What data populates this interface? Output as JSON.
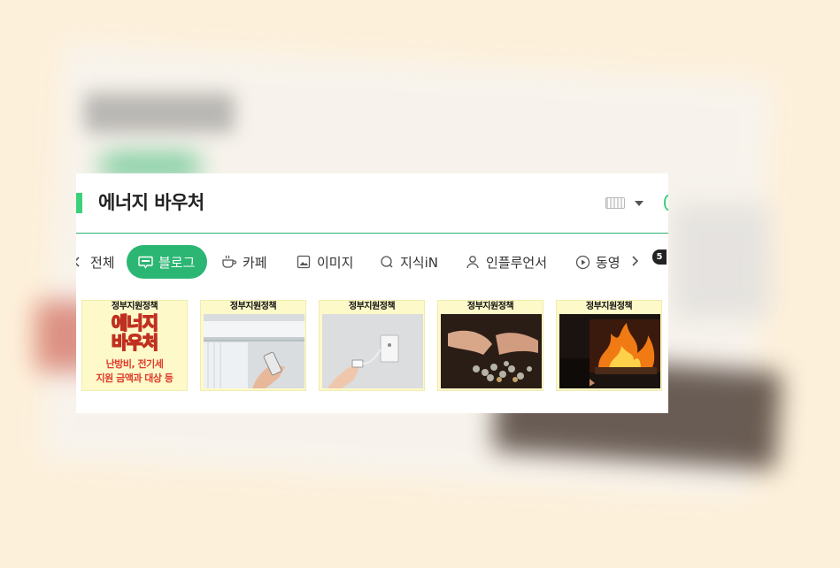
{
  "search": {
    "query": "에너지 바우처"
  },
  "tabs": [
    {
      "label": "전체",
      "icon": "chevron-left-icon"
    },
    {
      "label": "블로그",
      "icon": "blog-icon",
      "active": true
    },
    {
      "label": "카페",
      "icon": "cafe-icon"
    },
    {
      "label": "이미지",
      "icon": "image-icon"
    },
    {
      "label": "지식iN",
      "icon": "knowledge-icon"
    },
    {
      "label": "인플루언서",
      "icon": "person-icon"
    },
    {
      "label": "동영",
      "icon": "play-icon"
    }
  ],
  "more_icon": "chevron-right-icon",
  "thumbnails": [
    {
      "header": "정부지원정책",
      "main": "에너지\n바우처",
      "sub1": "난방비, 전기세",
      "sub2": "지원 금액과 대상 등"
    },
    {
      "header": "정부지원정책",
      "image": "air-conditioner-remote"
    },
    {
      "header": "정부지원정책",
      "image": "power-outlet-plug"
    },
    {
      "header": "정부지원정책",
      "image": "hands-coins"
    },
    {
      "header": "정부지원정책",
      "image": "fireplace",
      "badge": "5"
    }
  ],
  "colors": {
    "accent": "#2bb673",
    "accent_light": "#3cd07a",
    "background": "#fdf0db"
  }
}
